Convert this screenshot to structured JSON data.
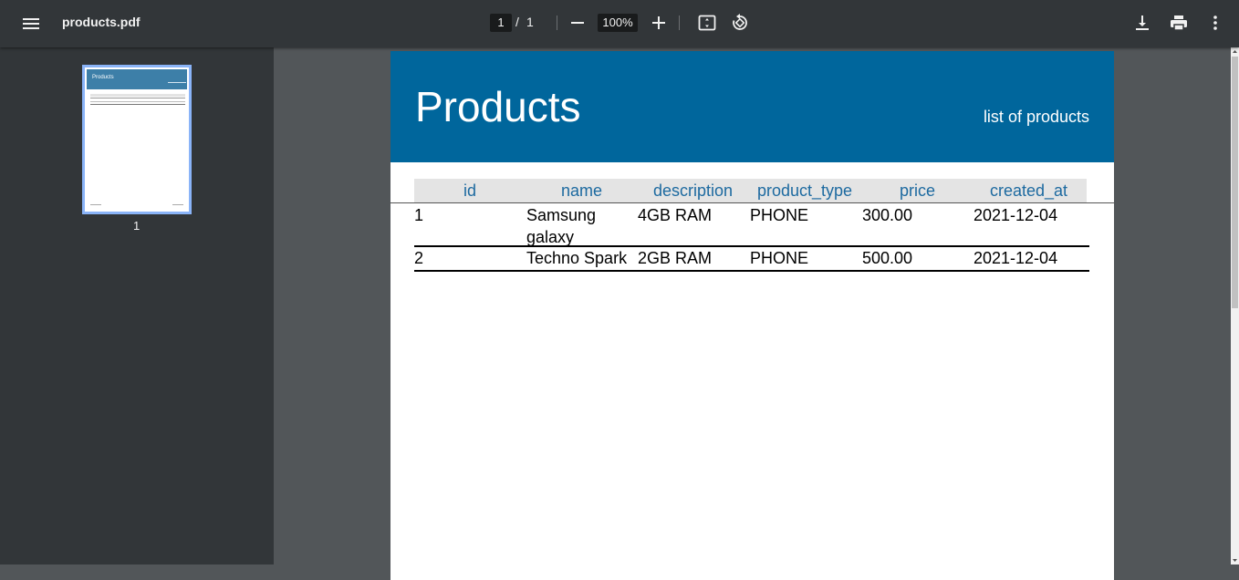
{
  "toolbar": {
    "title": "products.pdf",
    "page_current": "1",
    "page_separator": "/",
    "page_total": "1",
    "zoom": "100%",
    "icons": [
      "menu-icon",
      "zoom-out-icon",
      "zoom-in-icon",
      "fit-page-icon",
      "rotate-icon",
      "download-icon",
      "print-icon",
      "more-vert-icon"
    ]
  },
  "sidebar": {
    "thumbnail_label": "1",
    "thumbnail_title": "Products"
  },
  "document": {
    "title": "Products",
    "subtitle": "list of products",
    "columns": [
      "id",
      "name",
      "description",
      "product_type",
      "price",
      "created_at"
    ],
    "rows": [
      [
        "1",
        "Samsung galaxy",
        "4GB RAM",
        "PHONE",
        "300.00",
        "2021-12-04"
      ],
      [
        "2",
        "Techno Spark",
        "2GB RAM",
        "PHONE",
        "500.00",
        "2021-12-04"
      ]
    ]
  },
  "colors": {
    "toolbar": "#323639",
    "viewer_bg": "#525659",
    "header_blue": "#00669c",
    "column_header_text": "#1d6aa0",
    "thumbnail_border": "#8ab4f8"
  }
}
